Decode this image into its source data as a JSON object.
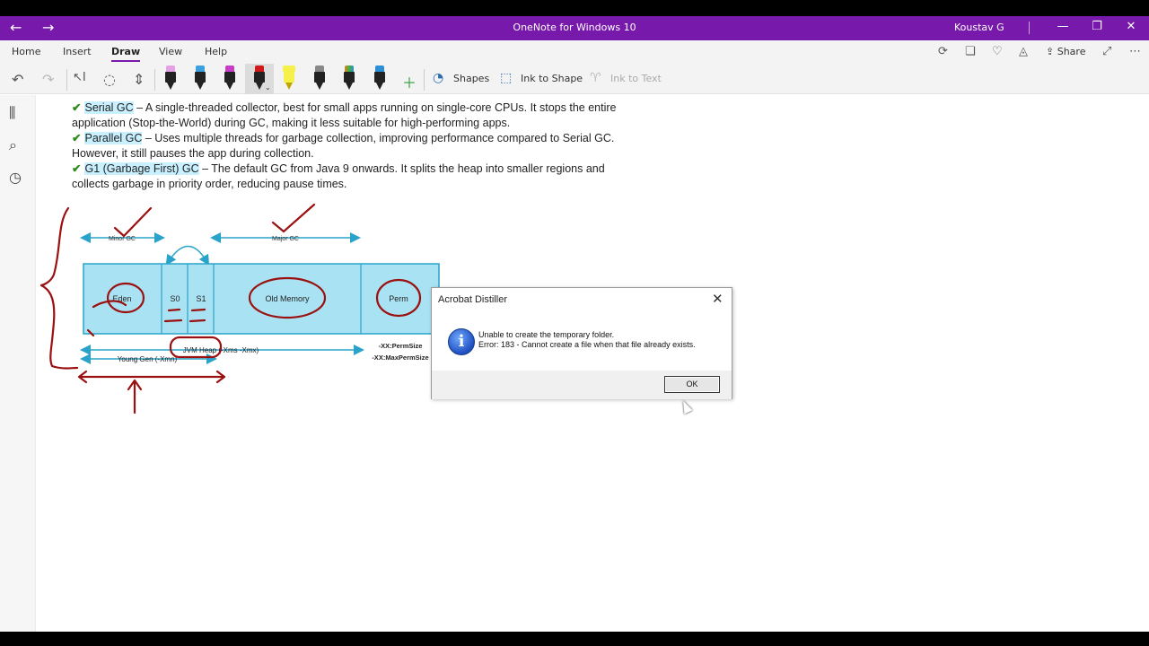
{
  "titlebar": {
    "back_icon": "←",
    "forward_icon": "→",
    "app_title": "OneNote for Windows 10",
    "user": "Koustav G",
    "min_icon": "—",
    "restore_icon": "❐",
    "close_icon": "✕",
    "bg_color": "#7719aa"
  },
  "menu": {
    "tabs": [
      "Home",
      "Insert",
      "Draw",
      "View",
      "Help"
    ],
    "active_tab": "Draw",
    "share_label": "Share"
  },
  "toolbar": {
    "shapes_label": "Shapes",
    "ink_to_shape_label": "Ink to Shape",
    "ink_to_text_label": "Ink to Text",
    "pen_colors": [
      "#e5a0e8",
      "#3aa0e0",
      "#c83cc8",
      "#d01a1a",
      "#f6f04a",
      "#888888",
      "#e57b22",
      "#2b8fd8"
    ]
  },
  "notes": {
    "items": [
      {
        "highlight": "Serial GC",
        "text": " – A single-threaded collector, best for small apps running on single-core CPUs. It stops the entire application (Stop-the-World) during GC, making it less suitable for high-performing apps."
      },
      {
        "highlight": "Parallel GC",
        "text": " – Uses multiple threads for garbage collection, improving performance compared to Serial GC. However, it still pauses the app during collection."
      },
      {
        "highlight": "G1 (Garbage First) GC",
        "text": "  – The default GC from Java 9 onwards. It splits the heap into smaller regions and collects garbage in priority order, reducing pause times."
      }
    ]
  },
  "diagram": {
    "minor_gc": "Minor GC",
    "major_gc": "Major GC",
    "eden": "Eden",
    "s0": "S0",
    "s1": "S1",
    "old_memory": "Old Memory",
    "perm": "Perm",
    "jvm_heap": "JVM Heap (-Xms -Xmx)",
    "young_gen": "Young Gen (-Xmn)",
    "perm_size": "-XX:PermSize",
    "max_perm_size": "-XX:MaxPermSize",
    "box_color": "#a9e3f3",
    "arrow_color": "#29a3c9",
    "ink_color": "#9b1010"
  },
  "dialog": {
    "title": "Acrobat Distiller",
    "close_icon": "✕",
    "info_icon": "i",
    "line1": "Unable to create the temporary folder.",
    "line2": "Error: 183 - Cannot create a file when that file already exists.",
    "ok_label": "OK"
  }
}
